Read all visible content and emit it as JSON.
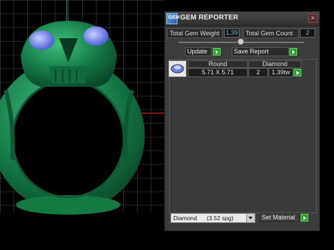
{
  "panel": {
    "title": "GEM REPORTER",
    "close_glyph": "×",
    "app_icon_text": "GEM",
    "total_weight_label": "Total Gem Weight",
    "total_weight_value": "1.39",
    "total_count_label": "Total Gem Count",
    "total_count_value": "2",
    "update_label": "Update",
    "save_label": "Save Report",
    "table": {
      "headers": [
        "Round",
        "Diamond"
      ],
      "rows": [
        {
          "size": "5.71 X 5.71",
          "count": "2",
          "weight": "1.39tw"
        }
      ]
    },
    "material_select": "Diamond      (3.52 spg)",
    "set_material_label": "Set Material"
  },
  "colors": {
    "accent_value": "#4fc3f0",
    "go_button": "#26a22a",
    "ring": "#1f8a4e",
    "gem": "#7a8ef0"
  },
  "icons": [
    "app-icon",
    "close-icon",
    "play-icon",
    "gem-thumbnail-icon",
    "dropdown-arrow-icon"
  ]
}
